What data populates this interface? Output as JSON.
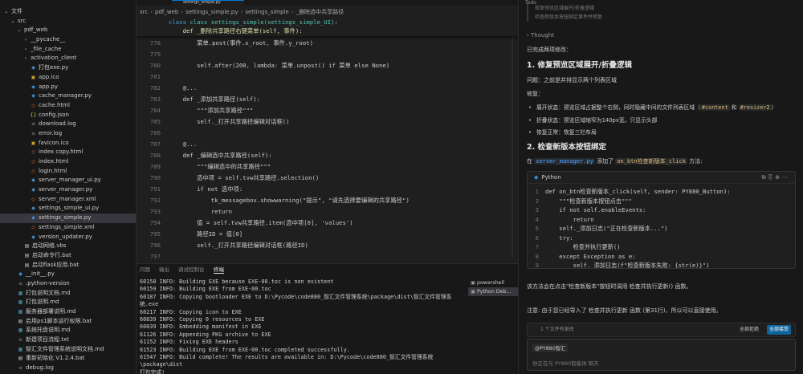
{
  "explorer": {
    "top_label": "",
    "items": [
      {
        "label": "文件",
        "depth": 0,
        "chevron": "v",
        "icon": ""
      },
      {
        "label": "src",
        "depth": 1,
        "chevron": "v",
        "icon": ""
      },
      {
        "label": "pdf_web",
        "depth": 2,
        "chevron": "v",
        "icon": ""
      },
      {
        "label": "__pycache__",
        "depth": 3,
        "chevron": ">",
        "icon": ""
      },
      {
        "label": "_file_cache",
        "depth": 3,
        "chevron": ">",
        "icon": ""
      },
      {
        "label": "activation_client",
        "depth": 3,
        "chevron": ">",
        "icon": ""
      },
      {
        "label": "打包exe.py",
        "depth": 3,
        "chevron": "",
        "icon": "py"
      },
      {
        "label": "app.ico",
        "depth": 3,
        "chevron": "",
        "icon": "ico"
      },
      {
        "label": "app.py",
        "depth": 3,
        "chevron": "",
        "icon": "py"
      },
      {
        "label": "cache_manager.py",
        "depth": 3,
        "chevron": "",
        "icon": "py"
      },
      {
        "label": "cache.html",
        "depth": 3,
        "chevron": "",
        "icon": "html"
      },
      {
        "label": "config.json",
        "depth": 3,
        "chevron": "",
        "icon": "json"
      },
      {
        "label": "download.log",
        "depth": 3,
        "chevron": "",
        "icon": "log"
      },
      {
        "label": "error.log",
        "depth": 3,
        "chevron": "",
        "icon": "log"
      },
      {
        "label": "favicon.ico",
        "depth": 3,
        "chevron": "",
        "icon": "ico"
      },
      {
        "label": "index copy.html",
        "depth": 3,
        "chevron": "",
        "icon": "html"
      },
      {
        "label": "index.html",
        "depth": 3,
        "chevron": "",
        "icon": "html"
      },
      {
        "label": "login.html",
        "depth": 3,
        "chevron": "",
        "icon": "html"
      },
      {
        "label": "server_manager_ui.py",
        "depth": 3,
        "chevron": "",
        "icon": "py"
      },
      {
        "label": "server_manager.py",
        "depth": 3,
        "chevron": "",
        "icon": "py"
      },
      {
        "label": "server_manager.xml",
        "depth": 3,
        "chevron": "",
        "icon": "xml"
      },
      {
        "label": "settings_simple_ui.py",
        "depth": 3,
        "chevron": "",
        "icon": "py"
      },
      {
        "label": "settings_simple.py",
        "depth": 3,
        "chevron": "",
        "icon": "py",
        "selected": true
      },
      {
        "label": "settings_simple.xml",
        "depth": 3,
        "chevron": "",
        "icon": "xml"
      },
      {
        "label": "version_updater.py",
        "depth": 3,
        "chevron": "",
        "icon": "py"
      },
      {
        "label": "启动网络.vbs",
        "depth": 2,
        "chevron": "",
        "icon": "bat"
      },
      {
        "label": "启动命令行.bat",
        "depth": 2,
        "chevron": "",
        "icon": "bat"
      },
      {
        "label": "启动flask应用.bat",
        "depth": 2,
        "chevron": "",
        "icon": "bat"
      },
      {
        "label": "__init__.py",
        "depth": 1,
        "chevron": "",
        "icon": "py"
      },
      {
        "label": ".python-version",
        "depth": 1,
        "chevron": "",
        "icon": "txt"
      },
      {
        "label": "打包说明文档.md",
        "depth": 1,
        "chevron": "",
        "icon": "md"
      },
      {
        "label": "打包说明.md",
        "depth": 1,
        "chevron": "",
        "icon": "md"
      },
      {
        "label": "服务器部署说明.md",
        "depth": 1,
        "chevron": "",
        "icon": "md"
      },
      {
        "label": "启用ps1脚本运行权限.bat",
        "depth": 1,
        "chevron": "",
        "icon": "bat"
      },
      {
        "label": "系统托盘说明.md",
        "depth": 1,
        "chevron": "",
        "icon": "md"
      },
      {
        "label": "新建项目流程.txt",
        "depth": 1,
        "chevron": "",
        "icon": "txt"
      },
      {
        "label": "智汇文件管理系统说明文档.md",
        "depth": 1,
        "chevron": "",
        "icon": "md"
      },
      {
        "label": "重新初始化 V1.2.4.bat",
        "depth": 1,
        "chevron": "",
        "icon": "bat"
      },
      {
        "label": "debug.log",
        "depth": 1,
        "chevron": "",
        "icon": "log"
      }
    ]
  },
  "editor": {
    "tab_label": "settings_simple.py",
    "breadcrumb": [
      "src",
      "pdf_web",
      "settings_simple.py",
      "settings_simple",
      "_删除选中共享路径"
    ],
    "sticky": [
      {
        "text": "class settings_simple(settings_simple_UI):",
        "kind": "cls"
      },
      {
        "text": "    def _删除共享路径右键菜单(self, 事件):",
        "kind": "def"
      }
    ],
    "lines": [
      {
        "n": "778",
        "text": "        菜单.post(事件.x_root, 事件.y_root)"
      },
      {
        "n": "779",
        "text": ""
      },
      {
        "n": "780",
        "text": "        self.after(200, lambda: 菜单.unpost() if 菜单 else None)"
      },
      {
        "n": "781",
        "text": ""
      },
      {
        "n": "782",
        "text": "    @..."
      },
      {
        "n": "783",
        "text": "    def _添加共享路径(self):"
      },
      {
        "n": "784",
        "text": "        \"\"\"添加共享路径\"\"\""
      },
      {
        "n": "785",
        "text": "        self._打开共享路径编辑对话框()"
      },
      {
        "n": "786",
        "text": ""
      },
      {
        "n": "787",
        "text": "    @..."
      },
      {
        "n": "788",
        "text": "    def _编辑选中共享路径(self):"
      },
      {
        "n": "789",
        "text": "        \"\"\"编辑选中的共享路径\"\"\""
      },
      {
        "n": "790",
        "text": "        选中项 = self.tvw共享路径.selection()"
      },
      {
        "n": "791",
        "text": "        if not 选中项:"
      },
      {
        "n": "792",
        "text": "            tk_messagebox.showwarning(\"提示\", \"请先选择要编辑的共享路径\")"
      },
      {
        "n": "793",
        "text": "            return"
      },
      {
        "n": "794",
        "text": "        值 = self.tvw共享路径.item(选中项[0], 'values')"
      },
      {
        "n": "795",
        "text": "        路径ID = 值[0]"
      },
      {
        "n": "796",
        "text": "        self._打开共享路径编辑对话框(路径ID)"
      },
      {
        "n": "797",
        "text": ""
      },
      {
        "n": "798",
        "text": "    @..."
      },
      {
        "n": "799",
        "text": "    def _删除选中共享路径(self):"
      },
      {
        "n": "800",
        "text": "        \"\"\"删除选中的共享路径\"\"\""
      },
      {
        "n": "801",
        "text": "        选中项 = self.tvw共享路径.selection()"
      }
    ]
  },
  "terminal": {
    "tabs": [
      "问题",
      "输出",
      "调试控制台",
      "终端"
    ],
    "active_tab": "终端",
    "output": "60158 INFO: Building EXE because EXE-00.toc is non existent\n60159 INFO: Building EXE from EXE-00.toc\n60187 INFO: Copying bootloader EXE to D:\\Pycode\\code880_智汇文件管理系统\\package\\dist\\智汇文件管理系统.exe\n60217 INFO: Copying icon to EXE\n60839 INFO: Copying 0 resources to EXE\n60839 INFO: Embedding manifest in EXE\n61126 INFO: Appending PKG archive to EXE\n61152 INFO: Fixing EXE headers\n61523 INFO: Building EXE from EXE-00.toc completed successfully.\n61547 INFO: Build complete! The results are available in: D:\\Pycode\\code880_智汇文件管理系统\\package\\dist\n打包完成!",
    "sessions": [
      {
        "label": "powershell",
        "active": false
      },
      {
        "label": "Python Deb...",
        "active": true
      }
    ]
  },
  "chat": {
    "header": "Todo",
    "todo_lines": [
      "修复预览区域展开/折叠逻辑",
      "检查新版本按钮绑定事件并修复"
    ],
    "thought_label": "Thought",
    "intro": "已完成两项修改：",
    "h1": "1. 修复预览区域展开/折叠逻辑",
    "problem_label": "问题：",
    "problem_text": "之前是并排显示两个列表区域",
    "fix_label": "修复：",
    "bullets": [
      {
        "pre": "展开状态：预览区域占据整个右侧，同时隐藏中间的文件列表区域（",
        "c1": "#content",
        "mid": " 和 ",
        "c2": "#resizer2",
        "post": "）"
      },
      {
        "pre": "折叠状态：预览区域缩窄为140px宽，只显示头部",
        "c1": "",
        "mid": "",
        "c2": "",
        "post": ""
      },
      {
        "pre": "恢复正常：恢复三栏布局",
        "c1": "",
        "mid": "",
        "c2": "",
        "post": ""
      }
    ],
    "h2": "2. 检查新版本按钮绑定",
    "binding_pre": "在 ",
    "binding_file": "server_manager.py",
    "binding_mid": " 添加了 ",
    "binding_code": "on_btn检查新版本_click",
    "binding_post": " 方法:",
    "code_lang": "Python",
    "code_lines": [
      {
        "n": "1",
        "text": "def on_btn检查新版本_click(self, sender: PY880_Button):"
      },
      {
        "n": "2",
        "text": "    \"\"\"检查新版本按钮点击\"\"\""
      },
      {
        "n": "3",
        "text": "    if not self.enableEvents:"
      },
      {
        "n": "4",
        "text": "        return"
      },
      {
        "n": "5",
        "text": "    self._添加日志(\"正在检查新版本...\")"
      },
      {
        "n": "6",
        "text": "    try:"
      },
      {
        "n": "7",
        "text": "        检查并执行更新()"
      },
      {
        "n": "8",
        "text": "    except Exception as e:"
      },
      {
        "n": "9",
        "text": "        self._添加日志(f\"检查新版本失败: {str(e)}\")"
      },
      {
        "n": "10",
        "text": "        Messagebox.show_info(f\"检查新版本功能: {str(e)}\", \"提示\")"
      }
    ],
    "after_code": "该方法会在点击\"检查新版本\"按钮时调用 检查并执行更新() 函数。",
    "note": "注意: 由于您已经导入了 检查并执行更新 函数 (第31行)，所以可以直接使用。",
    "changes_label": "1 个文件有更改",
    "undo_label": "全部拒绝",
    "keep_label": "全部接受",
    "context_chip": "@PY880智汇",
    "input_placeholder": "你正在与 PY880智能体 聊天"
  }
}
